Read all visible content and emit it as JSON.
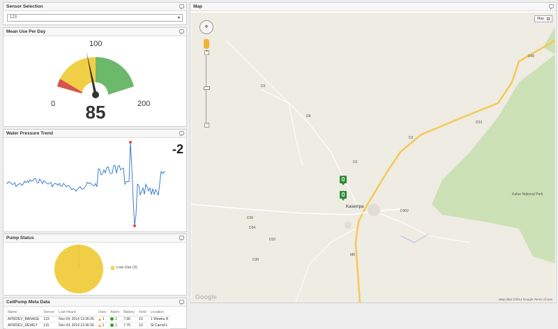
{
  "sensor": {
    "title": "Sensor Selection",
    "value": "123"
  },
  "mean_use": {
    "title": "Mean Use Per Day",
    "min": "0",
    "mid": "100",
    "max": "200",
    "value": "85",
    "level": 85,
    "range": [
      0,
      200
    ]
  },
  "trend": {
    "title": "Water Pressure Trend",
    "value": "-2"
  },
  "pump": {
    "title": "Pump Status",
    "legend": "Low Use (3)"
  },
  "meta": {
    "title": "CellPump Meta Data",
    "headers": [
      "Name",
      "Sensor",
      "Last Heard",
      "Uses",
      "Alarm",
      "Battery",
      "Field",
      "Location"
    ],
    "rows": [
      [
        "AFRIDEV_BANAGE",
        "123",
        "Nov 04, 2014 13:36:36",
        "1",
        "1",
        "7.66",
        "10",
        "1 Wewka R"
      ],
      [
        "AFRIDEV_DEWEY",
        "115",
        "Nov 04, 2014 13:36:36",
        "1",
        "1",
        "7.75",
        "13",
        "St Carroll L"
      ]
    ]
  },
  "map": {
    "title": "Map",
    "map_type": "Map",
    "town": "Kasempa",
    "labels": [
      "Kafue National Park",
      "D3",
      "D8",
      "D3",
      "D2",
      "D33",
      "D45",
      "M8",
      "D36",
      "D34",
      "D32",
      "D30",
      "D302"
    ],
    "google": "Google",
    "attribution": "Map data ©2014 Google   Terms of Use"
  },
  "colors": {
    "gauge_red": "#d9534f",
    "gauge_yellow": "#f0cf46",
    "gauge_green": "#6cb96c",
    "trend_line": "#3d7ecb",
    "park": "#cde1b6",
    "road": "#f5c954"
  }
}
